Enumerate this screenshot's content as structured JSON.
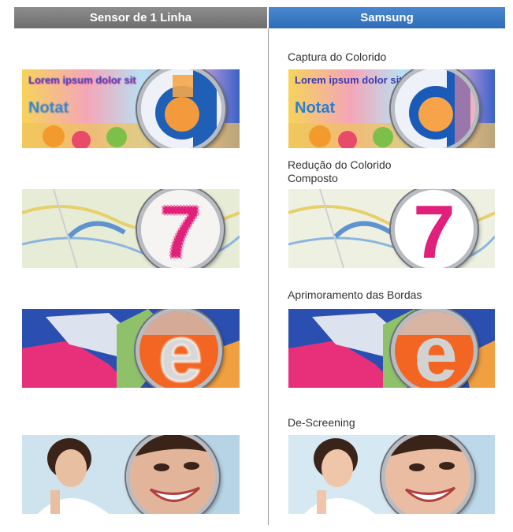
{
  "header": {
    "left_title": "Sensor de 1 Linha",
    "right_title": "Samsung"
  },
  "captions": [
    "Captura do Colorido",
    "Redução do Colorido\nComposto",
    "Aprimoramento das Bordas",
    "De-Screening"
  ],
  "samples": {
    "text_sample": {
      "headline": "Lorem ipsum dolor sit",
      "logo": "Notat"
    },
    "map_sample": {
      "digit": "7"
    },
    "vector_sample": {
      "letter": "e"
    },
    "photo_sample": {}
  },
  "icons": [
    "magnifier-lens-icon"
  ],
  "colors": {
    "header_left": "#7a7a7a",
    "header_right": "#3a78c4",
    "accent_pink": "#e0207a",
    "accent_orange": "#f26522",
    "accent_blue": "#1e5fb0"
  }
}
